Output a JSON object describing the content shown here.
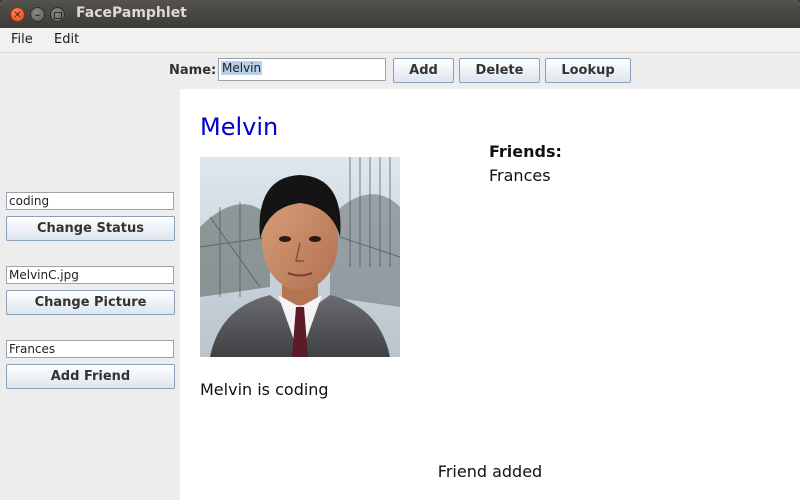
{
  "window": {
    "title": "FacePamphlet"
  },
  "menu": {
    "file": "File",
    "edit": "Edit"
  },
  "toolbar": {
    "name_label": "Name:",
    "name_value": "Melvin",
    "add_label": "Add",
    "delete_label": "Delete",
    "lookup_label": "Lookup"
  },
  "sidebar": {
    "status_value": "coding",
    "change_status_label": "Change Status",
    "picture_value": "MelvinC.jpg",
    "change_picture_label": "Change Picture",
    "friend_value": "Frances",
    "add_friend_label": "Add Friend"
  },
  "profile": {
    "name": "Melvin",
    "status": "Melvin is coding",
    "friends_title": "Friends:",
    "friends": [
      "Frances"
    ],
    "name_color": "#0000cc"
  },
  "message": "Friend added"
}
